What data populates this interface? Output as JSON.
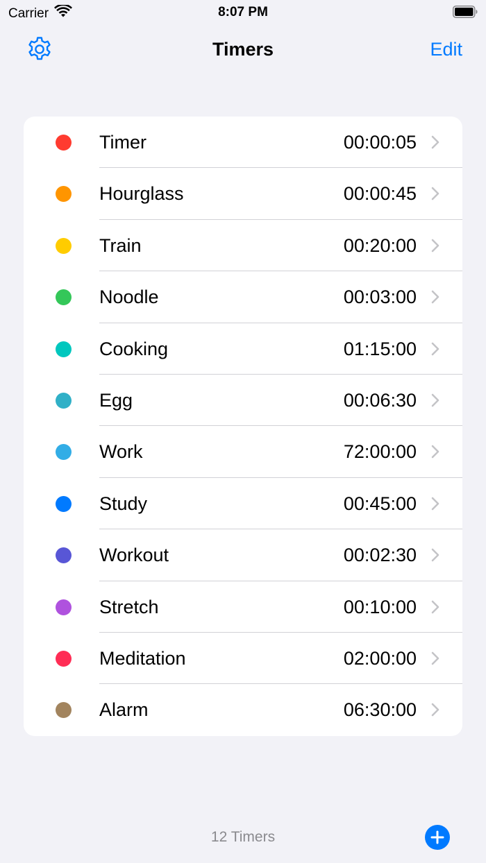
{
  "status_bar": {
    "carrier": "Carrier",
    "time": "8:07 PM",
    "wifi_icon": "wifi-icon",
    "battery_icon": "battery-icon"
  },
  "nav": {
    "title": "Timers",
    "edit_label": "Edit",
    "settings_icon": "gear-icon"
  },
  "colors": {
    "accent": "#007aff",
    "background": "#f2f2f7"
  },
  "timers": [
    {
      "name": "Timer",
      "duration": "00:00:05",
      "color": "#ff3b30"
    },
    {
      "name": "Hourglass",
      "duration": "00:00:45",
      "color": "#ff9500"
    },
    {
      "name": "Train",
      "duration": "00:20:00",
      "color": "#ffcc00"
    },
    {
      "name": "Noodle",
      "duration": "00:03:00",
      "color": "#34c759"
    },
    {
      "name": "Cooking",
      "duration": "01:15:00",
      "color": "#00c7be"
    },
    {
      "name": "Egg",
      "duration": "00:06:30",
      "color": "#30b0c7"
    },
    {
      "name": "Work",
      "duration": "72:00:00",
      "color": "#32ade6"
    },
    {
      "name": "Study",
      "duration": "00:45:00",
      "color": "#007aff"
    },
    {
      "name": "Workout",
      "duration": "00:02:30",
      "color": "#5856d6"
    },
    {
      "name": "Stretch",
      "duration": "00:10:00",
      "color": "#af52de"
    },
    {
      "name": "Meditation",
      "duration": "02:00:00",
      "color": "#ff2d55"
    },
    {
      "name": "Alarm",
      "duration": "06:30:00",
      "color": "#a2845e"
    }
  ],
  "footer": {
    "count_label": "12 Timers",
    "add_icon": "plus-icon"
  }
}
